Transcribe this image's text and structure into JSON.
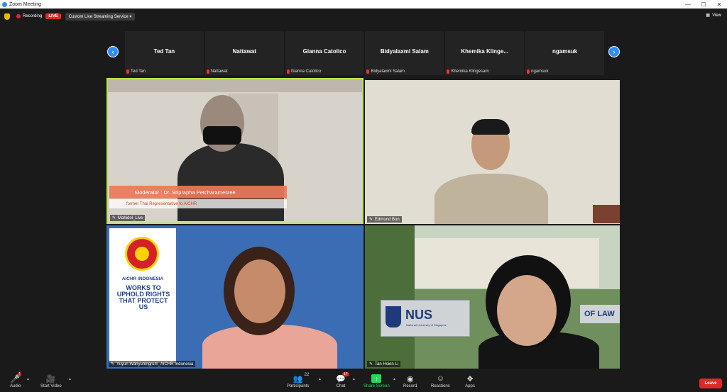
{
  "window": {
    "title": "Zoom Meeting"
  },
  "topbar": {
    "recording_label": "Recording",
    "live_badge": "LIVE",
    "stream_service": "Custom Live Streaming Service",
    "view_label": "View"
  },
  "strip": {
    "participants": [
      {
        "name": "Ted Tan",
        "label": "Ted Tan"
      },
      {
        "name": "Nattawat",
        "label": "Nattawat"
      },
      {
        "name": "Gianna Catolico",
        "label": "Gianna Catolico"
      },
      {
        "name": "Bidyalaxmi Salam",
        "label": "Bidyalaxmi Salam"
      },
      {
        "name": "Khemika Klinge...",
        "label": "Khemika Klingesarn"
      },
      {
        "name": "ngamsuk",
        "label": "ngamsuk"
      }
    ]
  },
  "tiles": [
    {
      "label": "Mahidol_Live",
      "overlay_title": "Moderator : Dr. Sriprapha Petcharamesree",
      "overlay_subtitle": "former Thai Representative to AICHR"
    },
    {
      "label": "Edmund Bon"
    },
    {
      "label": "Yuyun Wahyuningrum_AICHR Indonesia",
      "poster_title": "AICHR INDONESIA",
      "poster_slogan": "WORKS TO UPHOLD RIGHTS THAT PROTECT US"
    },
    {
      "label": "Tan Hsien Li",
      "sign_text": "NUS",
      "sign_sub": "National University of Singapore",
      "law_sign": "OF LAW"
    }
  ],
  "toolbar": {
    "audio": "Audio",
    "start_video": "Start Video",
    "participants": "Participants",
    "participants_count": "22",
    "chat": "Chat",
    "chat_badge": "17",
    "share_screen": "Share Screen",
    "record": "Record",
    "reactions": "Reactions",
    "apps": "Apps",
    "leave": "Leave"
  },
  "colors": {
    "accent": "#2d8cff",
    "live": "#e02828",
    "share_green": "#23d959",
    "active_speaker": "#b8e64b"
  }
}
